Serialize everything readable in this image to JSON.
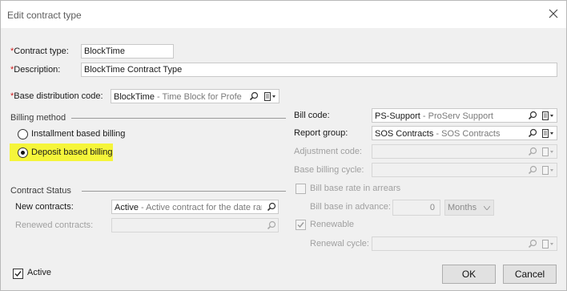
{
  "window": {
    "title": "Edit contract type"
  },
  "form": {
    "contract_type": {
      "label": "Contract type:",
      "value": "BlockTime"
    },
    "description": {
      "label": "Description:",
      "value": "BlockTime Contract Type"
    },
    "base_distribution_code": {
      "label": "Base distribution code:",
      "code": "BlockTime",
      "desc": " - Time Block for Professic"
    }
  },
  "billing_method": {
    "title": "Billing method",
    "options": [
      {
        "label": "Installment based billing",
        "selected": false
      },
      {
        "label": "Deposit based billing",
        "selected": true
      }
    ],
    "highlight_color": "#f5f53a"
  },
  "right": {
    "bill_code": {
      "label": "Bill code:",
      "code": "PS-Support",
      "desc": " - ProServ Support"
    },
    "report_group": {
      "label": "Report group:",
      "code": "SOS Contracts",
      "desc": " - SOS Contracts"
    },
    "adjustment_code": {
      "label": "Adjustment code:"
    },
    "base_billing_cycle": {
      "label": "Base billing cycle:"
    },
    "bill_base_rate_arrears": {
      "label": "Bill base rate in arrears",
      "checked": false
    },
    "bill_base_in_advance": {
      "label": "Bill base in advance:",
      "value": "0",
      "unit": "Months"
    },
    "renewable": {
      "label": "Renewable",
      "checked": true
    },
    "renewal_cycle": {
      "label": "Renewal cycle:"
    }
  },
  "contract_status": {
    "title": "Contract Status",
    "new_contracts": {
      "label": "New contracts:",
      "code": "Active",
      "desc": " - Active contract for the date ran"
    },
    "renewed_contracts": {
      "label": "Renewed contracts:"
    }
  },
  "footer": {
    "active": {
      "label": "Active",
      "checked": true
    },
    "ok_label": "OK",
    "cancel_label": "Cancel"
  },
  "icons": {
    "close": "close-icon",
    "lookup": "magnifier-icon",
    "dropdown": "document-dropdown-icon"
  }
}
